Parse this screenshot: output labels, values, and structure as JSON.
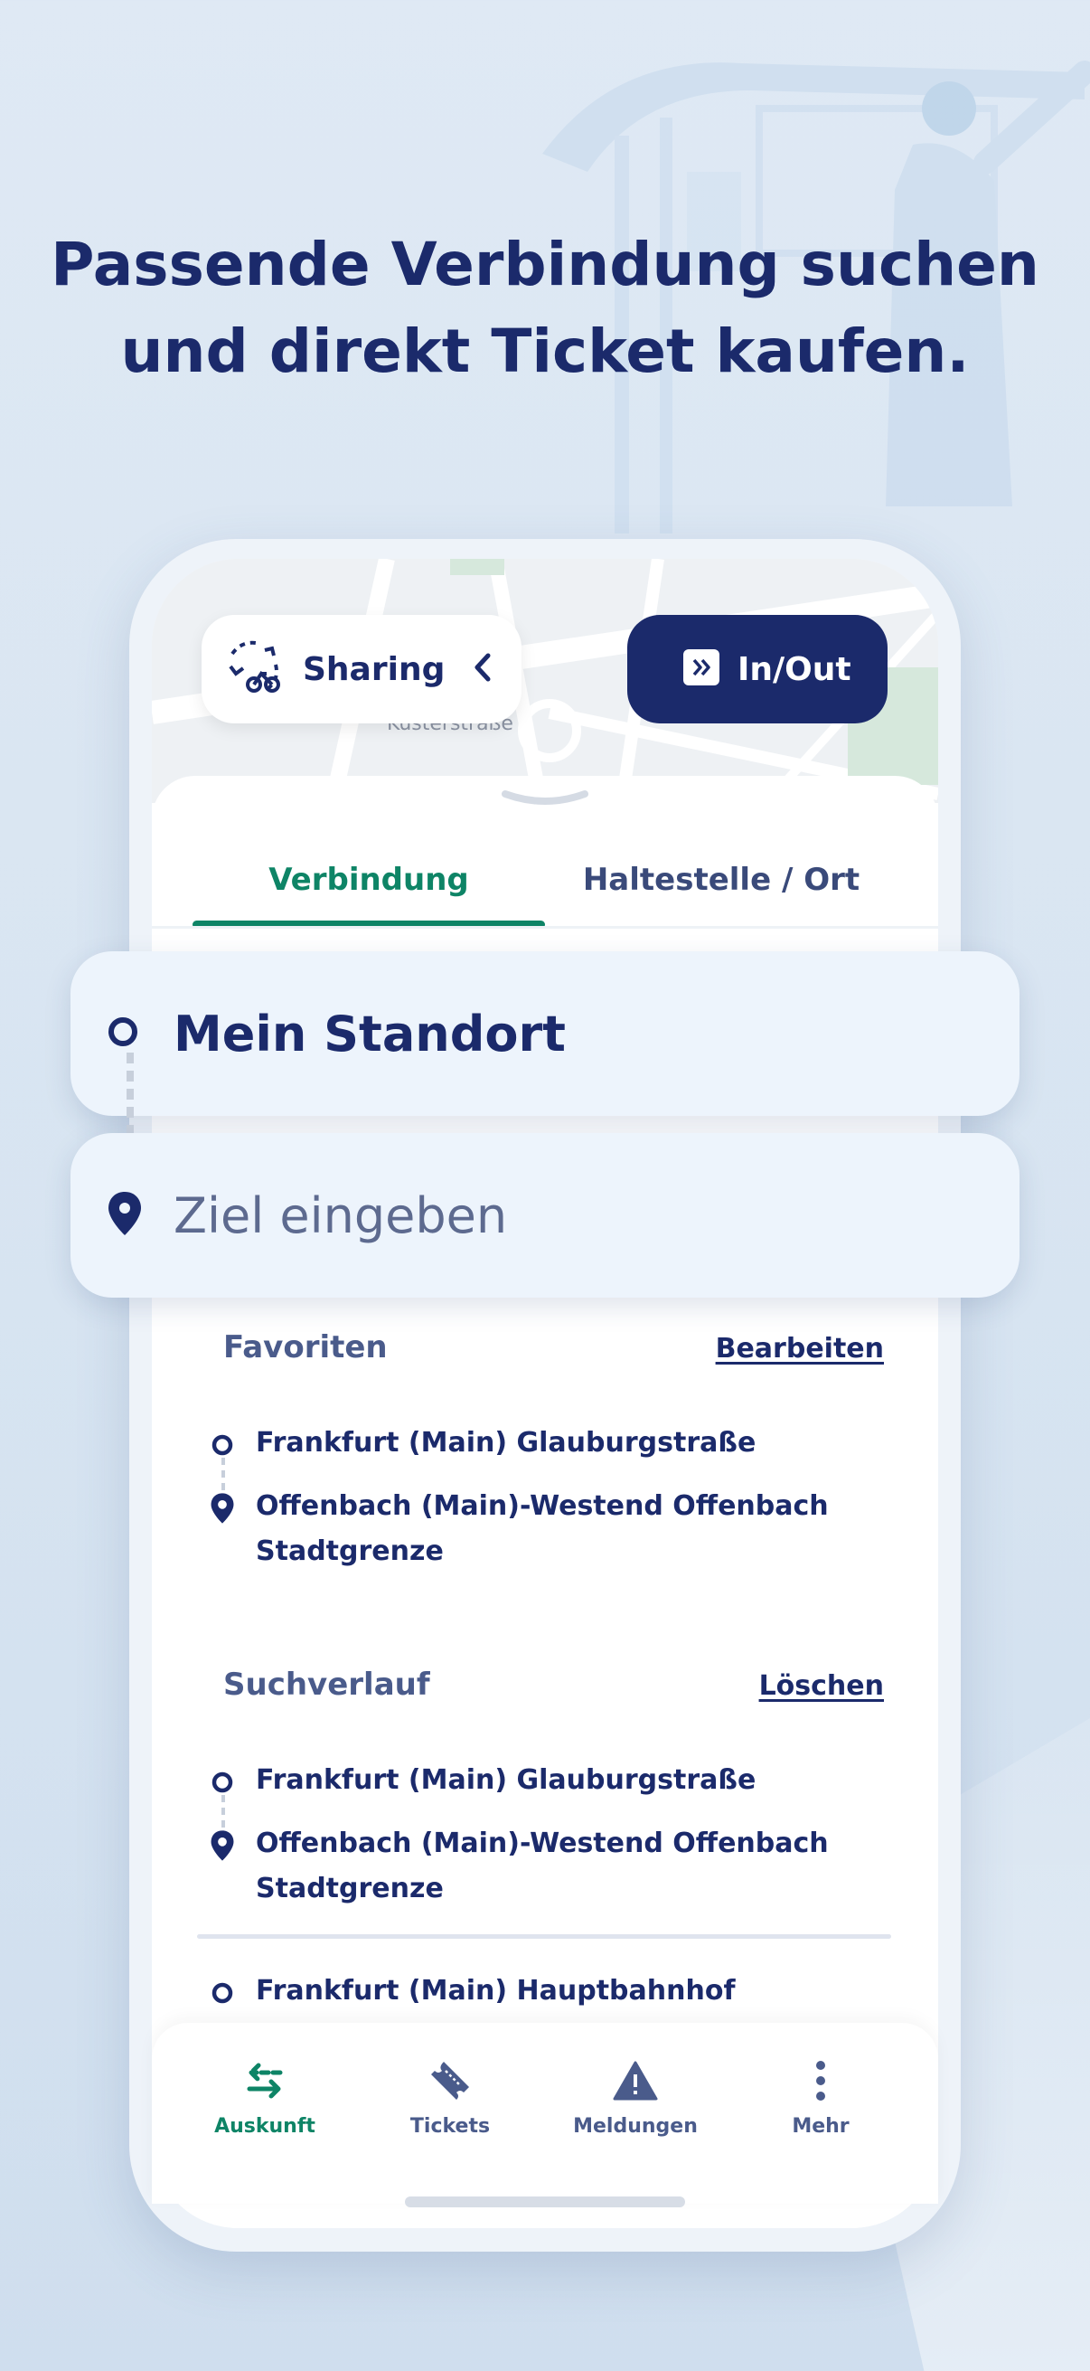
{
  "headline": {
    "line1": "Passende Verbindung suchen",
    "line2": "und direkt Ticket kaufen."
  },
  "map": {
    "street_label": "Küsterstraße"
  },
  "top_buttons": {
    "sharing_label": "Sharing",
    "inout_label": "In/Out"
  },
  "tabs": [
    {
      "label": "Verbindung",
      "active": true
    },
    {
      "label": "Haltestelle / Ort",
      "active": false
    }
  ],
  "search": {
    "from_value": "Mein Standort",
    "to_placeholder": "Ziel eingeben"
  },
  "favorites": {
    "title": "Favoriten",
    "action": "Bearbeiten",
    "from": "Frankfurt (Main) Glauburgstraße",
    "to_line1": "Offenbach (Main)-Westend Offenbach",
    "to_line2": "Stadtgrenze"
  },
  "history": {
    "title": "Suchverlauf",
    "action": "Löschen",
    "entry1_from": "Frankfurt (Main) Glauburgstraße",
    "entry1_to_line1": "Offenbach (Main)-Westend Offenbach",
    "entry1_to_line2": "Stadtgrenze",
    "entry2_from": "Frankfurt (Main) Hauptbahnhof"
  },
  "bottom_nav": [
    {
      "label": "Auskunft",
      "icon": "route-arrows-icon",
      "active": true
    },
    {
      "label": "Tickets",
      "icon": "ticket-icon",
      "active": false
    },
    {
      "label": "Meldungen",
      "icon": "warning-icon",
      "active": false
    },
    {
      "label": "Mehr",
      "icon": "more-vertical-icon",
      "active": false
    }
  ],
  "colors": {
    "primary": "#1b2a6b",
    "accent_green": "#0e8466",
    "field_bg": "#edf4fc",
    "page_bg": "#dfe9f4"
  }
}
